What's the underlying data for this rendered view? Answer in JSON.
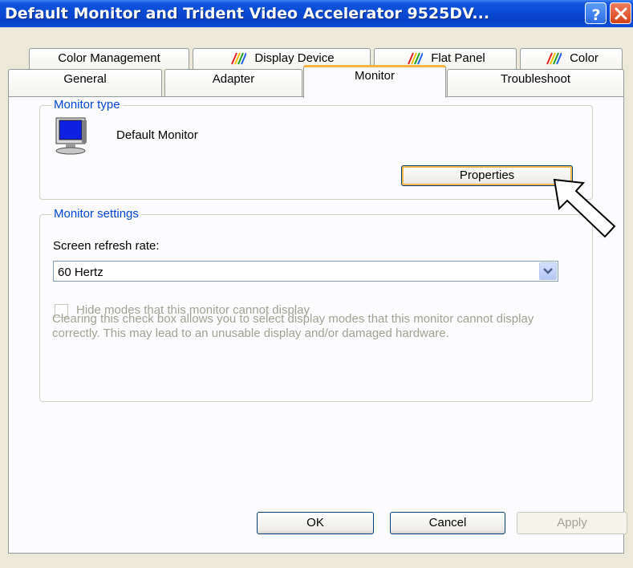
{
  "window": {
    "title": "Default Monitor and Trident Video Accelerator 9525DV...",
    "help_icon": "help-question-icon",
    "close_icon": "close-x-icon"
  },
  "tabs_back": [
    {
      "label": "Color Management",
      "icon": null
    },
    {
      "label": "Display Device",
      "icon": "color-stripes-icon"
    },
    {
      "label": "Flat Panel",
      "icon": "color-stripes-icon"
    },
    {
      "label": "Color",
      "icon": "color-stripes-icon"
    }
  ],
  "tabs_front": [
    {
      "label": "General"
    },
    {
      "label": "Adapter"
    },
    {
      "label": "Monitor",
      "active": true
    },
    {
      "label": "Troubleshoot"
    }
  ],
  "monitor_type": {
    "legend": "Monitor type",
    "monitor_icon": "monitor-icon",
    "name": "Default Monitor",
    "properties_button": "Properties"
  },
  "monitor_settings": {
    "legend": "Monitor settings",
    "refresh_label": "Screen refresh rate:",
    "refresh_value": "60 Hertz",
    "hide_modes_label": "Hide modes that this monitor cannot display",
    "hide_modes_checked": false,
    "description": "Clearing this check box allows you to select display modes that this monitor cannot display correctly. This may lead to an unusable display and/or damaged hardware."
  },
  "buttons": {
    "ok": "OK",
    "cancel": "Cancel",
    "apply": "Apply"
  },
  "colors": {
    "title_bar": "#0a4bd6",
    "dialog_bg": "#ece9d8",
    "group_legend": "#0046d5",
    "active_tab_accent": "#f6b43c",
    "disabled_text": "#a1a192"
  },
  "annotation": {
    "icon": "hollow-pointer-arrow-icon"
  }
}
